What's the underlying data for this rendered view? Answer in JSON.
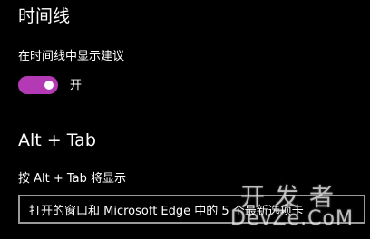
{
  "timeline": {
    "title": "时间线",
    "suggestions_label": "在时间线中显示建议",
    "toggle": {
      "state": "开",
      "on": true,
      "track_color": "#b439b5",
      "knob_color": "#ffffff"
    }
  },
  "alt_tab": {
    "title": "Alt + Tab",
    "show_label": "按 Alt + Tab 将显示",
    "dropdown_value": "打开的窗口和 Microsoft Edge 中的 5 个最新选项卡"
  },
  "watermark": {
    "line1": "开发者",
    "line2": "DevZe.CoM"
  },
  "colors": {
    "background": "#000000",
    "text": "#ffffff",
    "accent": "#b439b5",
    "dropdown_border": "#9a9a9a"
  }
}
